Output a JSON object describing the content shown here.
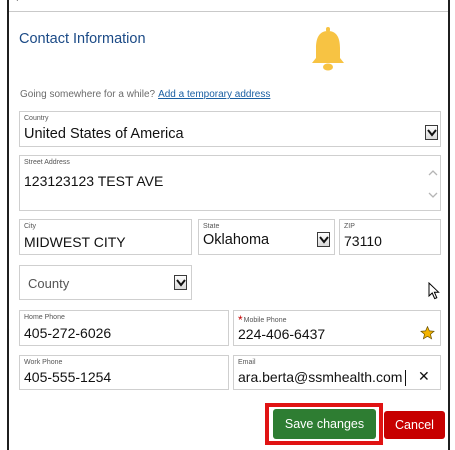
{
  "header": {
    "cut_text": "Y",
    "title": "Contact Information"
  },
  "prompt": {
    "text": "Going somewhere for a while?",
    "link": "Add a temporary address"
  },
  "country": {
    "label": "Country",
    "value": "United States of America"
  },
  "street": {
    "label": "Street Address",
    "value": "123123123 TEST AVE"
  },
  "city": {
    "label": "City",
    "value": "MIDWEST CITY"
  },
  "state": {
    "label": "State",
    "value": "Oklahoma"
  },
  "zip": {
    "label": "ZIP",
    "value": "73110"
  },
  "county": {
    "value": "County"
  },
  "home_phone": {
    "label": "Home Phone",
    "value": "405-272-6026"
  },
  "mobile_phone": {
    "required_mark": "*",
    "label": "Mobile Phone",
    "value": "224-406-6437"
  },
  "work_phone": {
    "label": "Work Phone",
    "value": "405-555-1254"
  },
  "email": {
    "label": "Email",
    "value": "ara.berta@ssmhealth.com",
    "clear_glyph": "✕"
  },
  "actions": {
    "save": "Save changes",
    "cancel": "Cancel"
  },
  "colors": {
    "title": "#1b4a86",
    "link": "#1a5fa3",
    "save": "#2e7d32",
    "cancel": "#c70000",
    "highlight": "#e01313",
    "bell": "#f7c343",
    "star": "#f4b400"
  }
}
